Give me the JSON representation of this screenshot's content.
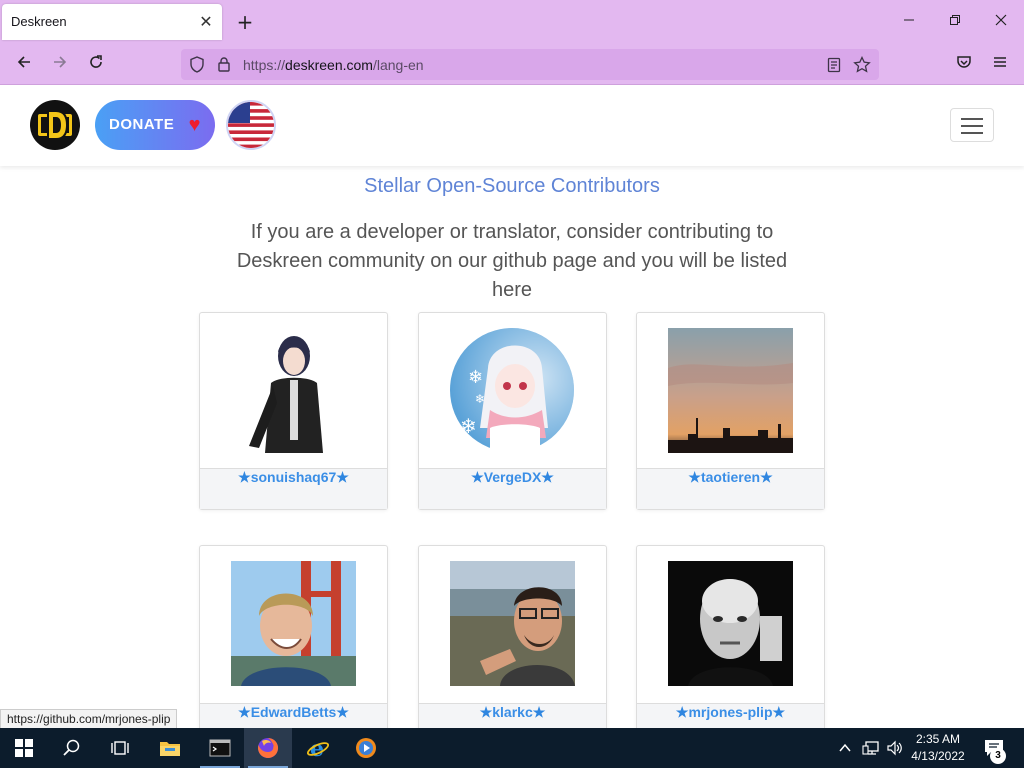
{
  "browser": {
    "tab_title": "Deskreen",
    "tab_close": "✕",
    "new_tab": "+",
    "url_prefix": "https://",
    "url_domain": "deskreen.com",
    "url_path": "/lang-en"
  },
  "header": {
    "donate_label": "DONATE",
    "heart": "♥"
  },
  "content": {
    "title": "Stellar Open-Source Contributors",
    "description": "If you are a developer or translator, consider contributing to Deskreen community on our github page and you will be listed here"
  },
  "contributors": [
    {
      "name": "sonuishaq67"
    },
    {
      "name": "VergeDX"
    },
    {
      "name": "taotieren"
    },
    {
      "name": "EdwardBetts"
    },
    {
      "name": "klarkc"
    },
    {
      "name": "mrjones-plip"
    }
  ],
  "status_bar": {
    "link": "https://github.com/mrjones-plip"
  },
  "taskbar": {
    "time": "2:35 AM",
    "date": "4/13/2022",
    "notifications": "3"
  },
  "colors": {
    "browser_chrome": "#e3b8f0",
    "title_blue": "#5f84d6",
    "name_blue": "#3a8ee6",
    "taskbar": "#0c1c2c"
  }
}
